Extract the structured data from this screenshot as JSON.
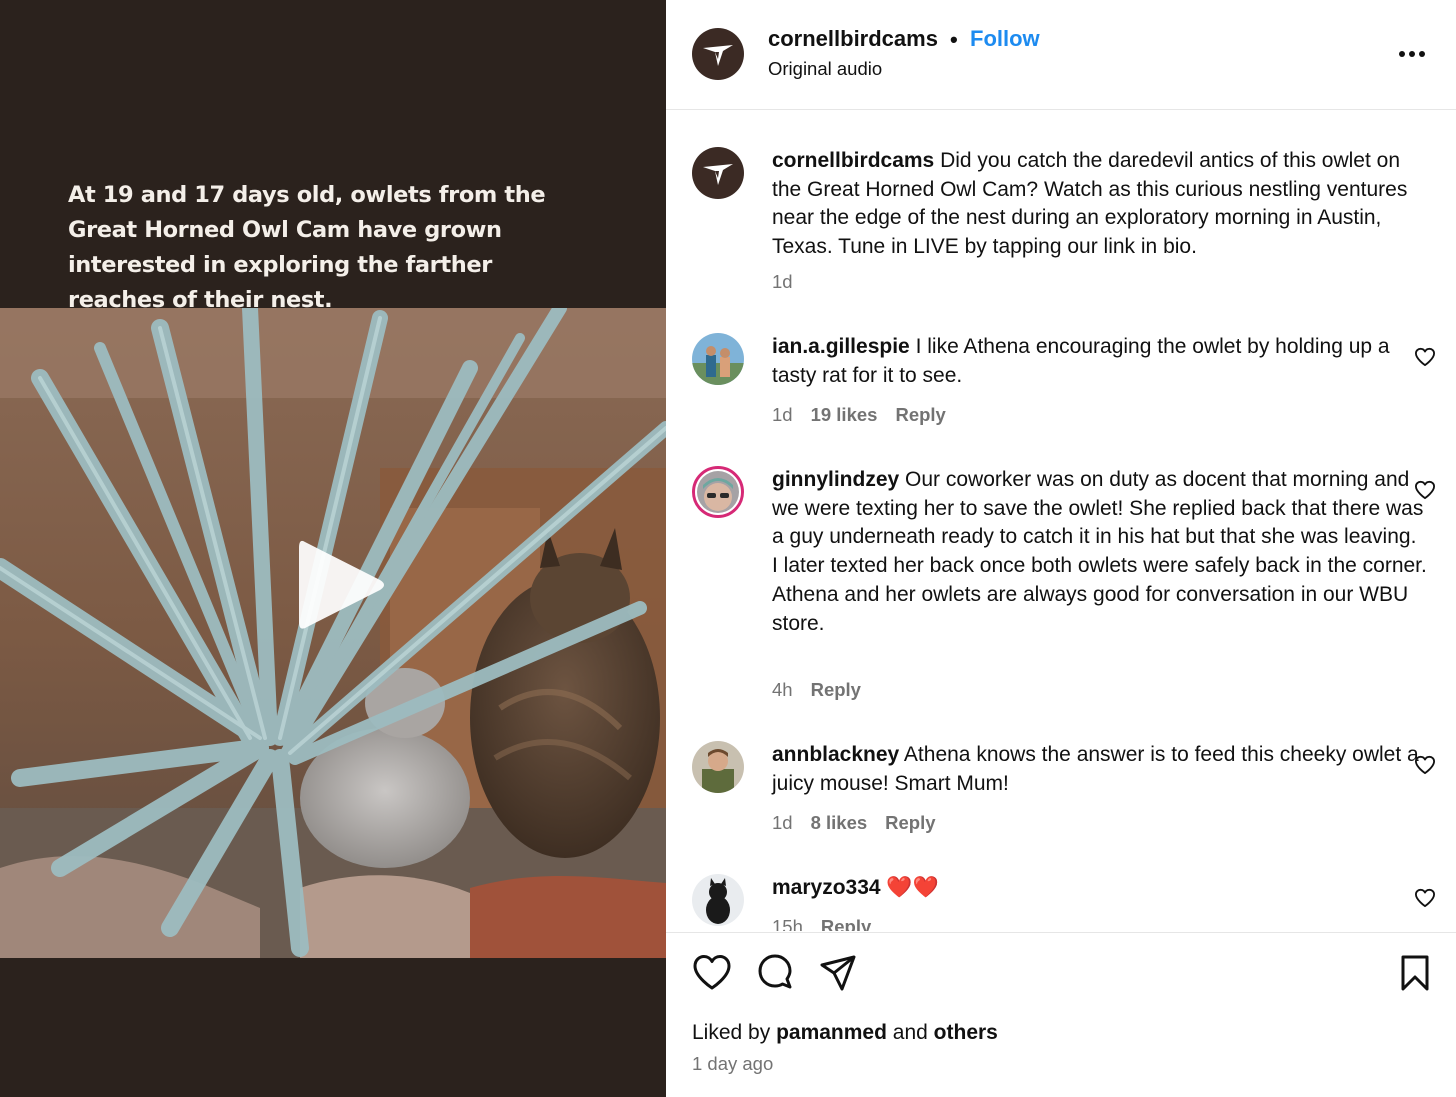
{
  "video": {
    "caption": "At 19 and 17 days old, owlets from the Great Horned Owl Cam have grown interested in exploring the farther reaches of their nest."
  },
  "header": {
    "username": "cornellbirdcams",
    "separator": "•",
    "follow_label": "Follow",
    "audio_label": "Original audio"
  },
  "caption_post": {
    "username": "cornellbirdcams",
    "text": "Did you catch the daredevil antics of this owlet on the Great Horned Owl Cam? Watch as this curious nestling ventures near the edge of the nest during an exploratory morning in Austin, Texas. Tune in LIVE by tapping our link in bio.",
    "time": "1d"
  },
  "comments": [
    {
      "username": "ian.a.gillespie",
      "text": "I like Athena encouraging the owlet by holding up a tasty rat for it to see.",
      "time": "1d",
      "likes": "19 likes",
      "reply": "Reply"
    },
    {
      "username": "ginnylindzey",
      "text": "Our coworker was on duty as docent that morning and we were texting her to save the owlet! She replied back that there was a guy underneath ready to catch it in his hat but that she was leaving. I later texted her back once both owlets were safely back in the corner. Athena and her owlets are always good for conversation in our WBU store.",
      "time": "4h",
      "likes": "",
      "reply": "Reply"
    },
    {
      "username": "annblackney",
      "text": "Athena knows the answer is to feed this cheeky owlet a juicy mouse! Smart Mum!",
      "time": "1d",
      "likes": "8 likes",
      "reply": "Reply"
    },
    {
      "username": "maryzo334",
      "text": "❤️❤️",
      "time": "15h",
      "likes": "",
      "reply": "Reply"
    }
  ],
  "footer": {
    "liked_by_prefix": "Liked by",
    "liked_by_user": "pamanmed",
    "liked_by_and": "and",
    "liked_by_others": "others",
    "post_time": "1 day ago"
  },
  "colors": {
    "follow_blue": "#1d8bf0",
    "video_bg": "#2b221d",
    "meta_gray": "#737373"
  },
  "icons": [
    "hummingbird-logo-icon",
    "more-options-icon",
    "heart-icon",
    "comment-icon",
    "share-icon",
    "bookmark-icon",
    "play-icon"
  ]
}
